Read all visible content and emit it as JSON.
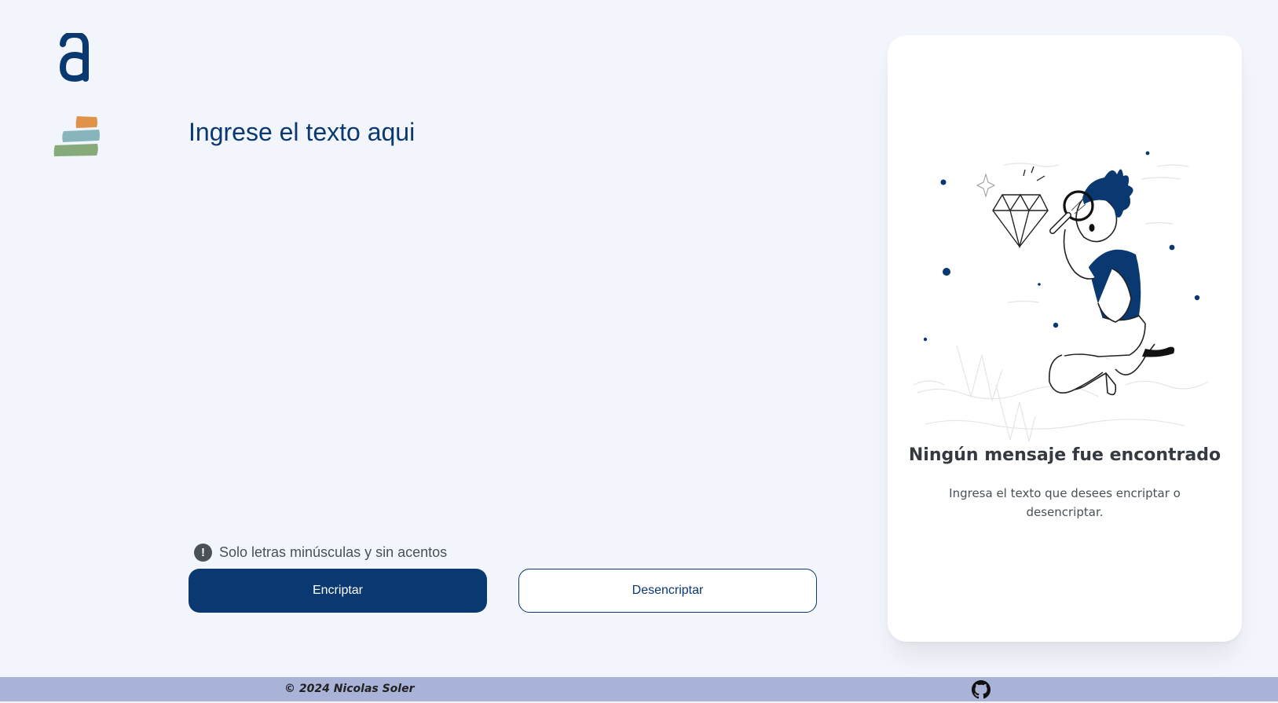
{
  "brand": {
    "logo_icon": "alura-a-logo-icon",
    "stack_icon": "color-stack-icon",
    "colors": {
      "primary": "#0a3871",
      "background": "#f3f5fc",
      "footer": "#a9b3d8",
      "stack_top": "#e0914a",
      "stack_middle": "#86b6bc",
      "stack_bottom": "#86aa7a"
    }
  },
  "input": {
    "placeholder": "Ingrese el texto aqui",
    "value": ""
  },
  "hint": {
    "icon": "exclamation-circle-icon",
    "text": "Solo letras minúsculas y sin acentos"
  },
  "actions": {
    "encrypt_label": "Encriptar",
    "decrypt_label": "Desencriptar"
  },
  "result": {
    "illustration": "person-with-magnifier-and-diamond-illustration",
    "title": "Ningún mensaje fue encontrado",
    "description": "Ingresa el texto que desees encriptar o desencriptar."
  },
  "footer": {
    "copyright": "© 2024 Nicolas Soler",
    "github_icon": "github-icon"
  }
}
